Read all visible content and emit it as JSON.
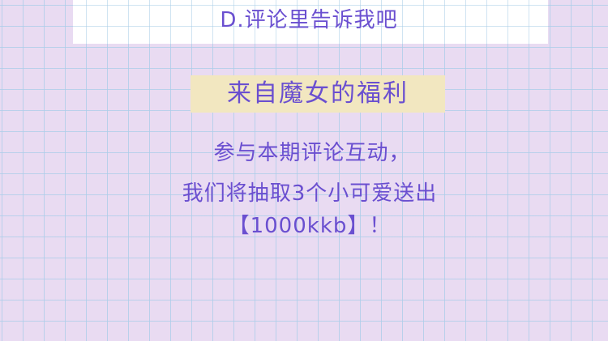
{
  "top_card": {
    "option_text": "D.评论里告诉我吧"
  },
  "banner": {
    "title": "来自魔女的福利"
  },
  "message": {
    "line1": "参与本期评论互动，",
    "line2": "我们将抽取3个小可爱送出",
    "line3": "【1000kkb】！"
  },
  "colors": {
    "text": "#6a4fd0",
    "background": "#e9dbf2",
    "grid": "#aacde8",
    "banner": "#f2e7c0",
    "card": "#ffffff"
  }
}
